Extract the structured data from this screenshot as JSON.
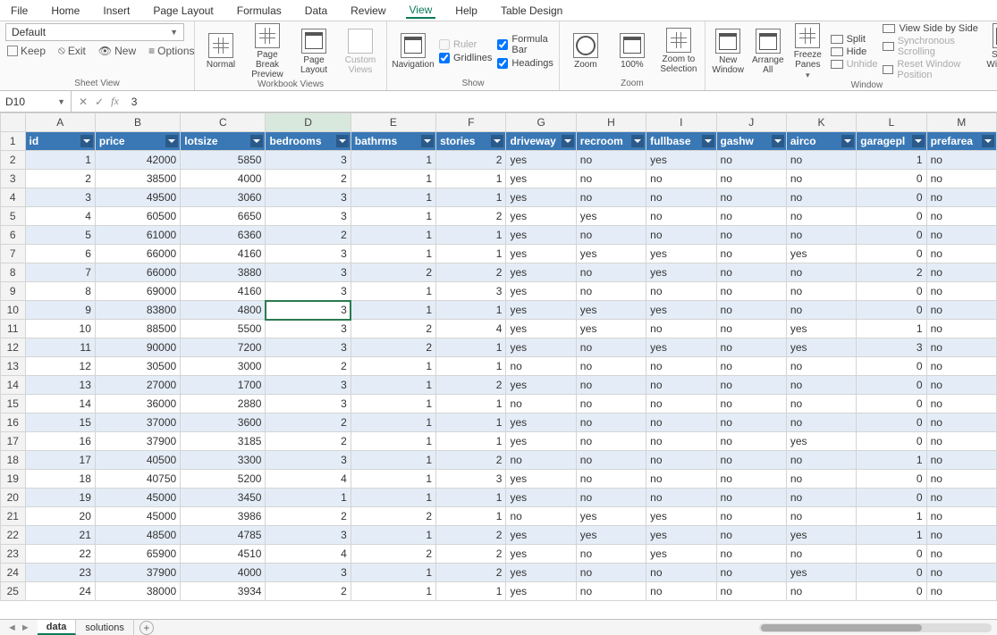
{
  "menu": [
    "File",
    "Home",
    "Insert",
    "Page Layout",
    "Formulas",
    "Data",
    "Review",
    "View",
    "Help",
    "Table Design"
  ],
  "menu_active": "View",
  "ribbon": {
    "style_select": "Default",
    "sheet_view": {
      "keep": "Keep",
      "exit": "Exit",
      "new": "New",
      "options": "Options",
      "label": "Sheet View"
    },
    "workbook_views": {
      "normal": "Normal",
      "page_break": "Page Break Preview",
      "page_layout": "Page Layout",
      "custom": "Custom Views",
      "label": "Workbook Views"
    },
    "show": {
      "navigation": "Navigation",
      "ruler": "Ruler",
      "formula_bar": "Formula Bar",
      "gridlines": "Gridlines",
      "headings": "Headings",
      "label": "Show"
    },
    "zoom": {
      "zoom": "Zoom",
      "pct": "100%",
      "to_sel": "Zoom to Selection",
      "label": "Zoom"
    },
    "window": {
      "new": "New Window",
      "arrange": "Arrange All",
      "freeze": "Freeze Panes",
      "split": "Split",
      "hide": "Hide",
      "unhide": "Unhide",
      "sbs": "View Side by Side",
      "sync": "Synchronous Scrolling",
      "reset": "Reset Window Position",
      "switch": "Switch Windows",
      "label": "Window"
    }
  },
  "active_cell": {
    "ref": "D10",
    "value": "3"
  },
  "columns": [
    "A",
    "B",
    "C",
    "D",
    "E",
    "F",
    "G",
    "H",
    "I",
    "J",
    "K",
    "L",
    "M"
  ],
  "headers": [
    "id",
    "price",
    "lotsize",
    "bedrooms",
    "bathrms",
    "stories",
    "driveway",
    "recroom",
    "fullbase",
    "gashw",
    "airco",
    "garagepl",
    "prefarea"
  ],
  "rows": [
    [
      "1",
      "42000",
      "5850",
      "3",
      "1",
      "2",
      "yes",
      "no",
      "yes",
      "no",
      "no",
      "1",
      "no"
    ],
    [
      "2",
      "38500",
      "4000",
      "2",
      "1",
      "1",
      "yes",
      "no",
      "no",
      "no",
      "no",
      "0",
      "no"
    ],
    [
      "3",
      "49500",
      "3060",
      "3",
      "1",
      "1",
      "yes",
      "no",
      "no",
      "no",
      "no",
      "0",
      "no"
    ],
    [
      "4",
      "60500",
      "6650",
      "3",
      "1",
      "2",
      "yes",
      "yes",
      "no",
      "no",
      "no",
      "0",
      "no"
    ],
    [
      "5",
      "61000",
      "6360",
      "2",
      "1",
      "1",
      "yes",
      "no",
      "no",
      "no",
      "no",
      "0",
      "no"
    ],
    [
      "6",
      "66000",
      "4160",
      "3",
      "1",
      "1",
      "yes",
      "yes",
      "yes",
      "no",
      "yes",
      "0",
      "no"
    ],
    [
      "7",
      "66000",
      "3880",
      "3",
      "2",
      "2",
      "yes",
      "no",
      "yes",
      "no",
      "no",
      "2",
      "no"
    ],
    [
      "8",
      "69000",
      "4160",
      "3",
      "1",
      "3",
      "yes",
      "no",
      "no",
      "no",
      "no",
      "0",
      "no"
    ],
    [
      "9",
      "83800",
      "4800",
      "3",
      "1",
      "1",
      "yes",
      "yes",
      "yes",
      "no",
      "no",
      "0",
      "no"
    ],
    [
      "10",
      "88500",
      "5500",
      "3",
      "2",
      "4",
      "yes",
      "yes",
      "no",
      "no",
      "yes",
      "1",
      "no"
    ],
    [
      "11",
      "90000",
      "7200",
      "3",
      "2",
      "1",
      "yes",
      "no",
      "yes",
      "no",
      "yes",
      "3",
      "no"
    ],
    [
      "12",
      "30500",
      "3000",
      "2",
      "1",
      "1",
      "no",
      "no",
      "no",
      "no",
      "no",
      "0",
      "no"
    ],
    [
      "13",
      "27000",
      "1700",
      "3",
      "1",
      "2",
      "yes",
      "no",
      "no",
      "no",
      "no",
      "0",
      "no"
    ],
    [
      "14",
      "36000",
      "2880",
      "3",
      "1",
      "1",
      "no",
      "no",
      "no",
      "no",
      "no",
      "0",
      "no"
    ],
    [
      "15",
      "37000",
      "3600",
      "2",
      "1",
      "1",
      "yes",
      "no",
      "no",
      "no",
      "no",
      "0",
      "no"
    ],
    [
      "16",
      "37900",
      "3185",
      "2",
      "1",
      "1",
      "yes",
      "no",
      "no",
      "no",
      "yes",
      "0",
      "no"
    ],
    [
      "17",
      "40500",
      "3300",
      "3",
      "1",
      "2",
      "no",
      "no",
      "no",
      "no",
      "no",
      "1",
      "no"
    ],
    [
      "18",
      "40750",
      "5200",
      "4",
      "1",
      "3",
      "yes",
      "no",
      "no",
      "no",
      "no",
      "0",
      "no"
    ],
    [
      "19",
      "45000",
      "3450",
      "1",
      "1",
      "1",
      "yes",
      "no",
      "no",
      "no",
      "no",
      "0",
      "no"
    ],
    [
      "20",
      "45000",
      "3986",
      "2",
      "2",
      "1",
      "no",
      "yes",
      "yes",
      "no",
      "no",
      "1",
      "no"
    ],
    [
      "21",
      "48500",
      "4785",
      "3",
      "1",
      "2",
      "yes",
      "yes",
      "yes",
      "no",
      "yes",
      "1",
      "no"
    ],
    [
      "22",
      "65900",
      "4510",
      "4",
      "2",
      "2",
      "yes",
      "no",
      "yes",
      "no",
      "no",
      "0",
      "no"
    ],
    [
      "23",
      "37900",
      "4000",
      "3",
      "1",
      "2",
      "yes",
      "no",
      "no",
      "no",
      "yes",
      "0",
      "no"
    ],
    [
      "24",
      "38000",
      "3934",
      "2",
      "1",
      "1",
      "yes",
      "no",
      "no",
      "no",
      "no",
      "0",
      "no"
    ]
  ],
  "sheet_tabs": [
    "data",
    "solutions"
  ],
  "active_tab": "data"
}
